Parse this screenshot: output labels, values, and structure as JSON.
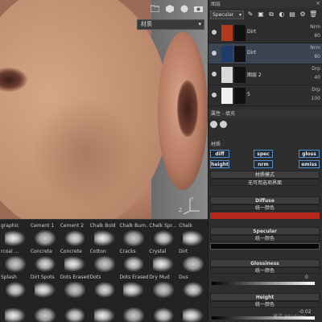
{
  "viewport": {
    "dropdown_label": "材质",
    "toolbar_icons": [
      "folder-icon",
      "cube-icon",
      "sphere-icon",
      "camera-icon"
    ],
    "axis_labels": {
      "y": "Y",
      "z": "Z"
    }
  },
  "shelf": {
    "rows": [
      [
        "graphic",
        "Cement 1",
        "Cement 2",
        "Chalk Bold",
        "Chalk Bum...",
        "Chalk Spr...",
        "Chalk"
      ],
      [
        "rcoal ...",
        "Concrete",
        "Concrete",
        "Cotton",
        "Cracks",
        "Crystal",
        "Dirt"
      ],
      [
        "Splash",
        "Dirt Spots",
        "Dots Erased",
        "Dots",
        "Dots Erased",
        "Dry Mud",
        "Dus"
      ],
      [
        "",
        "",
        "",
        "",
        "",
        "",
        ""
      ]
    ]
  },
  "layers": {
    "title": "图层",
    "channel": "Specular",
    "items": [
      {
        "name": "Dirt",
        "blend": "Nrm",
        "opacity": "80",
        "selected": false,
        "thumb": "#b23a1e"
      },
      {
        "name": "Dirt",
        "blend": "Nrm",
        "opacity": "80",
        "selected": true,
        "thumb": "#1f3b6b"
      },
      {
        "name": "图层 2",
        "blend": "Drp",
        "opacity": "40",
        "selected": false,
        "thumb": "#d9d9d9"
      },
      {
        "name": "5",
        "blend": "Drp",
        "opacity": "100",
        "selected": false,
        "thumb": "#f0f0f0"
      }
    ]
  },
  "properties": {
    "title": "属性 - 填充",
    "material_label": "材质",
    "channel_buttons": [
      "diff",
      "spec",
      "gloss",
      "height",
      "nrm",
      "emiss"
    ],
    "material_mode_label": "材质模式",
    "material_mode_value": "无可用选项界面",
    "sections": [
      {
        "title": "Diffuse",
        "sub": "统一颜色",
        "color": "#b5271a"
      },
      {
        "title": "Specular",
        "sub": "统一颜色",
        "color": "#050505"
      },
      {
        "title": "Glossiness",
        "sub": "统一颜色"
      },
      {
        "title": "Height",
        "sub": "统一颜色"
      }
    ],
    "gloss_value": "0",
    "height_value": "-0.02",
    "watermark": "激活 Windows"
  }
}
